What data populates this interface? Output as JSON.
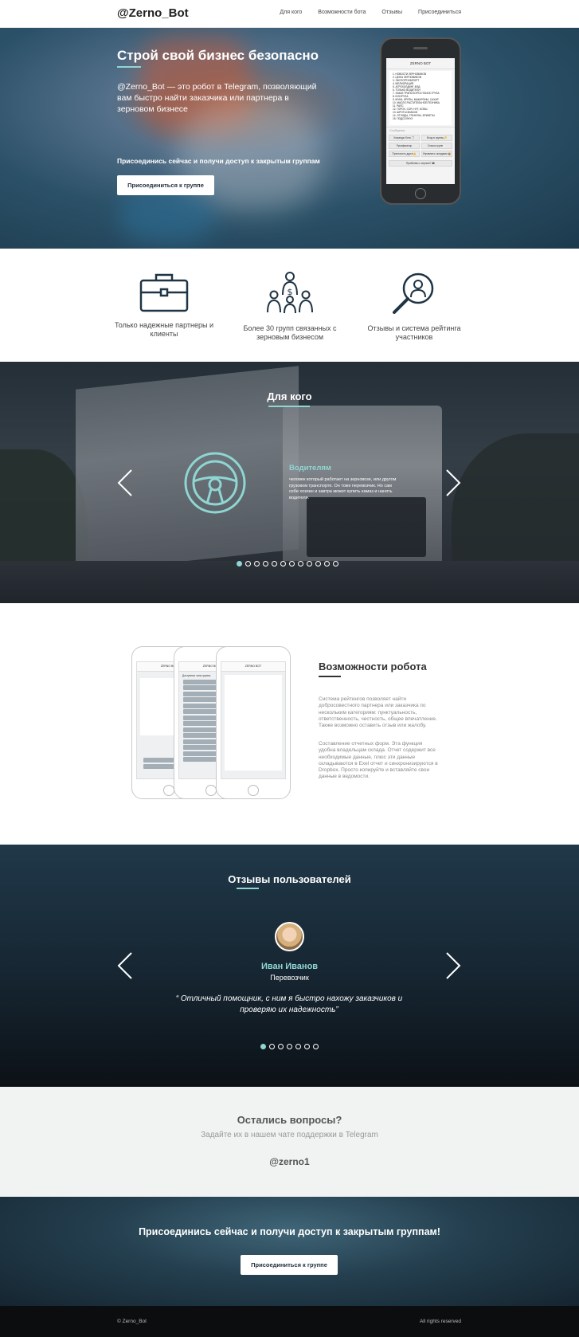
{
  "nav": {
    "brand": "@Zerno_Bot",
    "links": [
      "Для кого",
      "Возможности бота",
      "Отзывы",
      "Присоединиться"
    ]
  },
  "hero": {
    "title": "Строй свой бизнес безопасно",
    "description": "@Zerno_Bot — это робот в Telegram, позволяющий вам быстро найти заказчика или партнера в зерновом бизнесе",
    "cta_text": "Присоединись сейчас и получи доступ к закрытым группам",
    "button": "Присоединиться к группе"
  },
  "phone": {
    "header": "ZERNO BOT",
    "list": [
      "1. НОВОСТИ ЗЕРНОВИКОВ",
      "2. ЦЕНЫ ЗЕРНОВИКОВ",
      "3. ЭКСПОРТ/ИМПОРТ",
      "4. МЕЛИОРАЦИЯ",
      "5. АГРОХОЛДИНГ-ВЭД",
      "6. ТОЛЬКО ВОДИТЕЛИ",
      "7. ЗАКАЗ ТРАНСПОРТА ПОИСК ГРУЗА",
      "8. КУКУРУЗА",
      "9. МУКА, КРУПЫ, МАКАРОНЫ, САХАР",
      "10. МАСЛО РАСТИТЕЛЬНОЕ/ТЕХНИКА",
      "11. РАПС",
      "12. ГОРОХ, СОЯ, НУТ, БОБЫ",
      "13. ШРОТЫ ЖМЫХИ",
      "14. ОТХОДЫ, ГРАНУЛЫ, БРИКЕТЫ",
      "15. ПОДСОЛНУХ"
    ],
    "input_placeholder": "Сообщение",
    "buttons": [
      "Команды бота 📋",
      "Вход в группы🔑",
      "Русификатор",
      "Список групп📄",
      "Пригласить друга👍",
      "Управлять складами 📦"
    ],
    "wide_button": "Проблемы с зерном? ☎"
  },
  "features": [
    {
      "icon": "briefcase-icon",
      "text": "Только надежные партнеры и клиенты"
    },
    {
      "icon": "people-money-icon",
      "text": "Более 30 групп связанных с зерновым бизнесом"
    },
    {
      "icon": "search-person-icon",
      "text": "Отзывы и система рейтинга участников"
    }
  ],
  "forwhom": {
    "title": "Для кого",
    "slide_title": "Водителям",
    "slide_text": "человек который работает на зерновозе, или другом грузовом транспорте. Он тоже перевозчик. Но сам себе хозяин и завтра может купить камаз и нанять водителя.",
    "dots": 12,
    "active_dot": 0
  },
  "robot": {
    "title": "Возможности робота",
    "p1": "Система рейтингов позволяет найти добросовестного партнера или заказчика по нескольким категориям: пунктуальность, ответственность, честность, общее впечатление. Также возможно оставить отзыв или жалобу.",
    "p2": "Составление отчетных форм. Эта функция удобна владельцам склада. Отчет содержит все необходимые данные, плюс эти данные складываются в Exel отчет и синхронизируются в Dropbox. Просто копируйте и вставляйте свои данные в ведомости.",
    "phone_header": "ZERNO BOT",
    "phone2_title": "Доступные чаты группы"
  },
  "reviews": {
    "title": "Отзывы пользователей",
    "name": "Иван Иванов",
    "role": "Перевозчик",
    "quote": "“ Отличный помощник, с ним я быстро нахожу заказчиков и проверяю их надежность”",
    "dots": 7,
    "active_dot": 0
  },
  "questions": {
    "title": "Остались вопросы?",
    "subtitle": "Задайте их в нашем чате поддержки в Telegram",
    "handle": "@zerno1"
  },
  "cta": {
    "title": "Присоединись сейчас и получи доступ к закрытым группам!",
    "button": "Присоединиться к группе"
  },
  "footer": {
    "left": "© Zerno_Bot",
    "right": "All rights reserved"
  },
  "colors": {
    "accent": "#8fd6d3",
    "dark": "#1f2d3a"
  }
}
